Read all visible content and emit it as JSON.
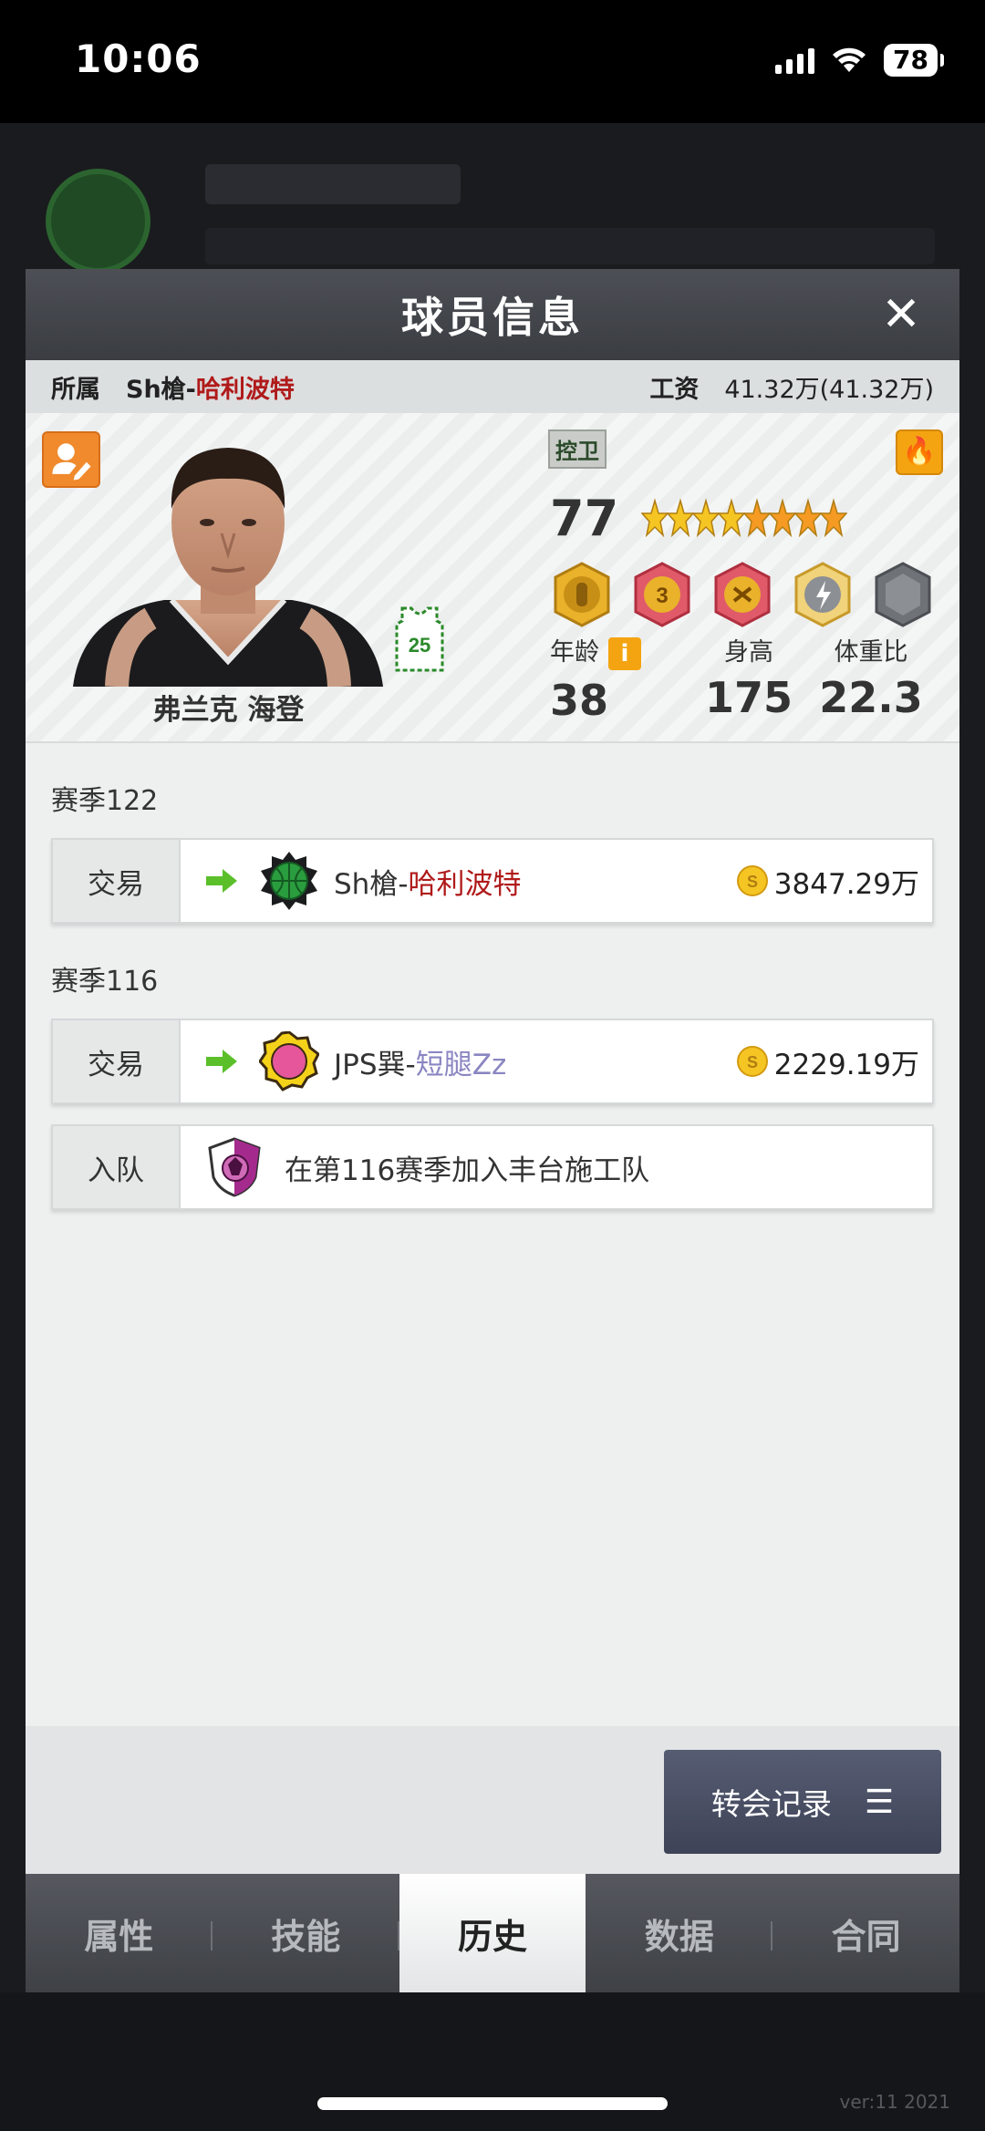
{
  "status_bar": {
    "time": "10:06",
    "battery": "78"
  },
  "background": {
    "version": "ver:11 2021"
  },
  "modal": {
    "title": "球员信息",
    "close_label": "✕"
  },
  "info_bar": {
    "team_label": "所属",
    "team_prefix": "Sh槍-",
    "team_suffix": "哈利波特",
    "salary_label": "工资",
    "salary_value": "41.32万(41.32万)"
  },
  "player": {
    "name": "弗兰克 海登",
    "jersey_number": "25",
    "position": "控卫",
    "rating": "77",
    "stars": 8,
    "star_colors": [
      "#f5c623",
      "#f5c623",
      "#f5c623",
      "#f5c623",
      "#f59a23",
      "#f59a23",
      "#f59a23",
      "#f59a23"
    ],
    "age_label": "年龄",
    "age": "38",
    "height_label": "身高",
    "height": "175",
    "weight_ratio_label": "体重比",
    "weight_ratio": "22.3",
    "info_icon": "i",
    "fire_icon": "🔥"
  },
  "history": {
    "seasons": [
      {
        "title": "赛季122",
        "events": [
          {
            "type": "交易",
            "team_prefix": "Sh槍-",
            "team_suffix": "哈利波特",
            "price": "3847.29万"
          }
        ]
      },
      {
        "title": "赛季116",
        "events": [
          {
            "type": "交易",
            "team_prefix": "JPS巽-",
            "team_suffix": "短腿Zz",
            "price": "2229.19万"
          },
          {
            "type": "入队",
            "text": "在第116赛季加入丰台施工队"
          }
        ]
      }
    ]
  },
  "footer": {
    "transfer_label": "转会记录",
    "menu_icon": "☰"
  },
  "tabs": [
    "属性",
    "技能",
    "历史",
    "数据",
    "合同"
  ],
  "active_tab": "历史",
  "colors": {
    "team_red": "#b01a1a",
    "team_purple": "#8a86c2",
    "accent_orange": "#f4a411",
    "header_dark": "#3a3d42"
  }
}
